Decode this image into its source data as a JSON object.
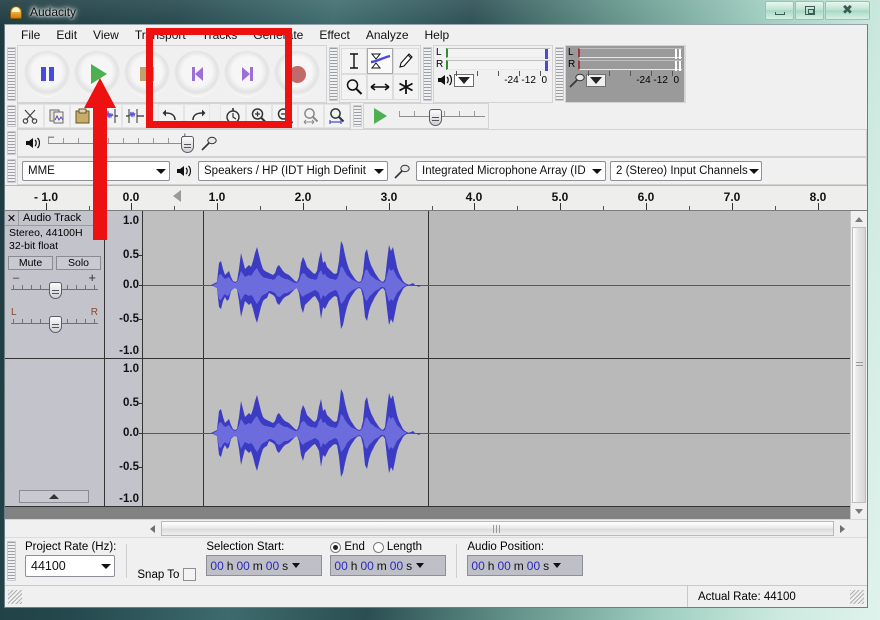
{
  "window": {
    "title": "Audacity",
    "app_icon": "audacity-logo-icon",
    "buttons": {
      "minimize": "minimize-button",
      "maximize": "maximize-button",
      "close": "close-button"
    }
  },
  "menubar": {
    "items": [
      "File",
      "Edit",
      "View",
      "Transport",
      "Tracks",
      "Generate",
      "Effect",
      "Analyze",
      "Help"
    ]
  },
  "transport": {
    "buttons": [
      {
        "name": "pause",
        "label": "Pause"
      },
      {
        "name": "play",
        "label": "Play"
      },
      {
        "name": "stop",
        "label": "Stop"
      },
      {
        "name": "skip-to-start",
        "label": "Skip to Start"
      },
      {
        "name": "skip-to-end",
        "label": "Skip to End"
      },
      {
        "name": "record",
        "label": "Record"
      }
    ]
  },
  "tools": {
    "items": [
      {
        "name": "selection-tool",
        "selected": false
      },
      {
        "name": "envelope-tool",
        "selected": true
      },
      {
        "name": "draw-tool",
        "selected": false
      },
      {
        "name": "zoom-tool",
        "selected": false
      },
      {
        "name": "timeshift-tool",
        "selected": false
      },
      {
        "name": "multi-tool",
        "selected": false
      }
    ]
  },
  "meters": {
    "playback": {
      "channels": [
        "L",
        "R"
      ],
      "scale": [
        "-24",
        "-12",
        "0"
      ],
      "icon": "speaker-icon"
    },
    "record": {
      "channels": [
        "L",
        "R"
      ],
      "scale": [
        "-24",
        "-12",
        "0"
      ],
      "icon": "microphone-icon"
    }
  },
  "edit_toolbar": {
    "items": [
      "cut-icon",
      "copy-icon",
      "paste-icon",
      "trim-outside-icon",
      "silence-selection-icon",
      "undo-icon",
      "redo-icon",
      "zoom-toggle-icon",
      "zoom-in-icon",
      "zoom-out-icon",
      "fit-selection-icon",
      "fit-project-icon",
      "play-at-speed-icon"
    ]
  },
  "mixer": {
    "output_icon": "speaker-icon",
    "input_icon": "microphone-icon",
    "output_minus": "–",
    "output_plus": "+"
  },
  "device_toolbar": {
    "host": {
      "label": "MME",
      "name": "audio-host-select"
    },
    "output_icon": "speaker-icon",
    "output_device": {
      "label": "Speakers / HP (IDT High Definit",
      "name": "output-device-select"
    },
    "input_icon": "microphone-icon",
    "input_device": {
      "label": "Integrated Microphone Array (ID",
      "name": "input-device-select"
    },
    "input_channels": {
      "label": "2 (Stereo) Input Channels",
      "name": "input-channels-select"
    }
  },
  "ruler": {
    "labels": [
      "- 1.0",
      "0.0",
      "1.0",
      "2.0",
      "3.0",
      "4.0",
      "5.0",
      "6.0",
      "7.0",
      "8.0"
    ],
    "positions": [
      41,
      126,
      212,
      298,
      384,
      469,
      555,
      641,
      727,
      813
    ]
  },
  "tracks": [
    {
      "name": "Audio Track",
      "close_glyph": "✕",
      "info_line1": "Stereo, 44100H",
      "info_line2": "32-bit float",
      "mute_label": "Mute",
      "solo_label": "Solo",
      "gain": {
        "left": "–",
        "right": "+"
      },
      "pan": {
        "left": "L",
        "right": "R"
      },
      "vruler_labels": [
        "1.0",
        "0.5",
        "0.0",
        "-0.5",
        "-1.0"
      ]
    }
  ],
  "channels": [
    {
      "name": "left-channel",
      "vruler_labels": [
        "1.0",
        "0.5",
        "0.0",
        "-0.5",
        "-1.0"
      ]
    },
    {
      "name": "right-channel",
      "vruler_labels": [
        "1.0",
        "0.5",
        "0.0",
        "-0.5",
        "-1.0"
      ]
    }
  ],
  "selection_bar": {
    "project_rate_label": "Project Rate (Hz):",
    "project_rate_value": "44100",
    "snap_to_label": "Snap To",
    "snap_to_checked": false,
    "selection_start_label": "Selection Start:",
    "end_label": "End",
    "length_label": "Length",
    "end_selected": true,
    "selection_start_value": {
      "hh": "00",
      "mm": "00",
      "ss": "00"
    },
    "selection_end_value": {
      "hh": "00",
      "mm": "00",
      "ss": "00"
    },
    "audio_position_label": "Audio Position:",
    "audio_position_value": {
      "hh": "00",
      "mm": "00",
      "ss": "00"
    },
    "units": {
      "h": "h",
      "m": "m",
      "s": "s"
    }
  },
  "status_bar": {
    "message": "",
    "actual_rate": "Actual Rate: 44100"
  },
  "annotation": {
    "rect": "red-highlight-rectangle",
    "arrow": "red-arrow-pointing-to-play-button",
    "color": "#ee1111"
  },
  "colors": {
    "waveform_outline": "#3b3bc4",
    "waveform_rms": "#6c6cdd",
    "track_background": "#bfbfbf",
    "play_green": "#4caf50",
    "record_red": "#c06a6a"
  }
}
